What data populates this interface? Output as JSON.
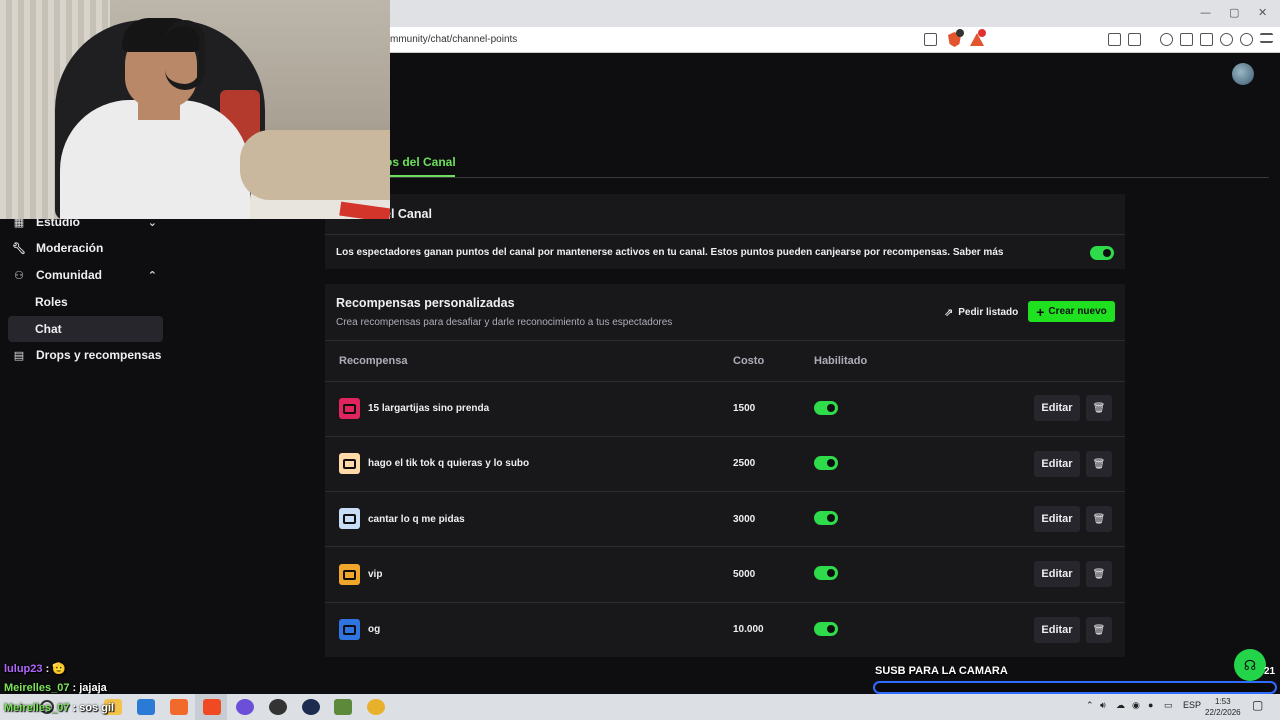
{
  "browser": {
    "url": "mmunity/chat/channel-points",
    "window_controls": [
      "—",
      "▢",
      "✕"
    ]
  },
  "header": {
    "active_tab": "os del Canal"
  },
  "sidebar": {
    "items": [
      {
        "label": "Estudio",
        "icon": "studio-icon"
      },
      {
        "label": "Moderación",
        "icon": "wrench-icon"
      },
      {
        "label": "Comunidad",
        "icon": "community-icon"
      },
      {
        "label": "Drops y recompensas",
        "icon": "gift-icon"
      }
    ],
    "sub_items": [
      {
        "label": "Roles"
      },
      {
        "label": "Chat",
        "active": true
      }
    ]
  },
  "channel_points": {
    "title": "el Canal",
    "description": "Los espectadores ganan puntos del canal por mantenerse activos en tu canal. Estos puntos pueden canjearse por recompensas. Saber más",
    "enabled": true
  },
  "custom_rewards": {
    "title": "Recompensas personalizadas",
    "subtitle": "Crea recompensas para desafiar y darle reconocimiento a tus espectadores",
    "btn_list": "Pedir listado",
    "btn_new": "Crear nuevo",
    "columns": {
      "reward": "Recompensa",
      "cost": "Costo",
      "enabled": "Habilitado"
    },
    "edit_label": "Editar",
    "rows": [
      {
        "name": "15 largartijas sino prenda",
        "cost": "1500",
        "color": "#e0245e",
        "enabled": true
      },
      {
        "name": "hago el tik tok q quieras y lo subo",
        "cost": "2500",
        "color": "#ffd9a8",
        "enabled": true
      },
      {
        "name": "cantar lo q me pidas",
        "cost": "3000",
        "color": "#c8dcf5",
        "enabled": true
      },
      {
        "name": "vip",
        "cost": "5000",
        "color": "#f0a52b",
        "enabled": true
      },
      {
        "name": "og",
        "cost": "10.000",
        "color": "#2f74e0",
        "enabled": true
      }
    ]
  },
  "chat_overlay": [
    {
      "user": "lulup23",
      "message": "🫡",
      "color": "purple"
    },
    {
      "user": "Meirelles_07",
      "message": "jajaja",
      "color": "green"
    },
    {
      "user": "Meirelles_07",
      "message": "sos gil",
      "color": "green"
    }
  ],
  "overlay": {
    "goal_label": "SUSB PARA LA CAMARA",
    "goal_count": "21",
    "goal_progress": 0.0
  },
  "taskbar": {
    "lang": "ESP",
    "time": "1:53",
    "date": "22/2/2026"
  }
}
